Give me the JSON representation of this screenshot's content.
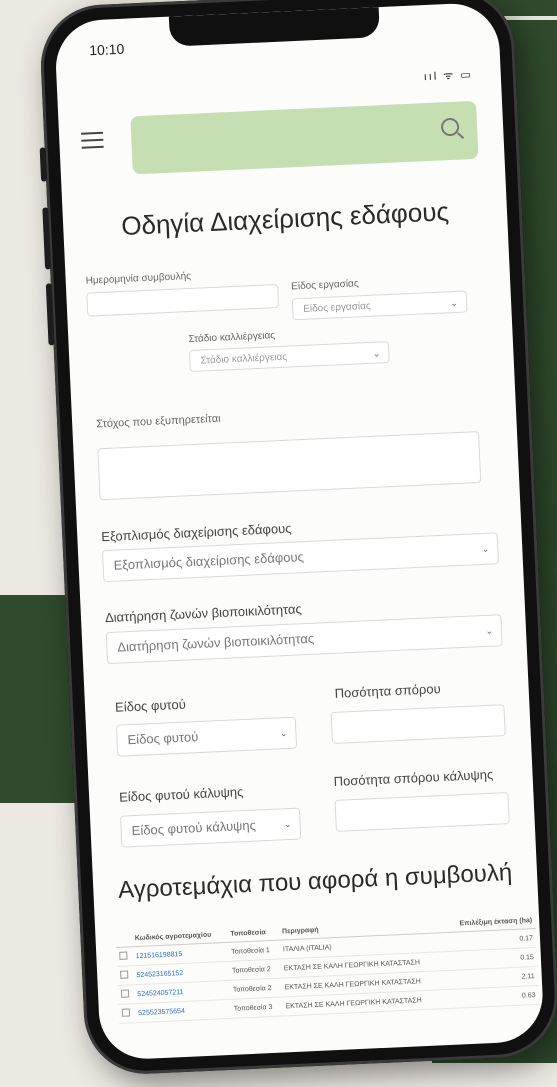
{
  "status_bar": {
    "time": "10:10",
    "icons": "ııl ᯤ ▭"
  },
  "search": {
    "placeholder": ""
  },
  "form": {
    "title": "Οδηγία Διαχείρισης εδάφους",
    "date_label": "Ημερομηνία συμβουλής",
    "work_type_label": "Είδος εργασίας",
    "work_type_value": "Είδος εργασίας",
    "stage_label": "Στάδιο καλλιέργειας",
    "stage_value": "Στάδιο καλλιέργειας",
    "goal_label": "Στόχος που εξυπηρετείται",
    "equipment_label": "Εξοπλισμός διαχείρισης εδάφους",
    "equipment_value": "Εξοπλισμός διαχείρισης εδάφους",
    "biodiversity_label": "Διατήρηση ζωνών βιοποικιλότητας",
    "biodiversity_value": "Διατήρηση ζωνών βιοποικιλότητας",
    "plant_label": "Είδος φυτού",
    "plant_value": "Είδος φυτού",
    "seed_qty_label": "Ποσότητα σπόρου",
    "cover_plant_label": "Είδος φυτού κάλυψης",
    "cover_plant_value": "Είδος φυτού κάλυψης",
    "cover_seed_qty_label": "Ποσότητα σπόρου κάλυψης"
  },
  "parcels": {
    "title": "Αγροτεμάχια που αφορά η συμβουλή",
    "headers": [
      "",
      "Κωδικός αγροτεμαχίου",
      "Τοποθεσία",
      "Περιγραφή",
      "Επιλέξιμη έκταση (ha)"
    ],
    "rows": [
      {
        "code": "121516198815",
        "location": "Τοποθεσία 1",
        "description": "ΙΤΑΛΙΑ (ITALIA)",
        "area": "0.17"
      },
      {
        "code": "524523165152",
        "location": "Τοποθεσία 2",
        "description": "ΕΚΤΑΣΗ ΣΕ ΚΑΛΗ ΓΕΩΡΓΙΚΗ ΚΑΤΑΣΤΑΣΗ",
        "area": "0.15"
      },
      {
        "code": "524524057211",
        "location": "Τοποθεσία 2",
        "description": "ΕΚΤΑΣΗ ΣΕ ΚΑΛΗ ΓΕΩΡΓΙΚΗ ΚΑΤΑΣΤΑΣΗ",
        "area": "2.11"
      },
      {
        "code": "525523575654",
        "location": "Τοποθεσία 3",
        "description": "ΕΚΤΑΣΗ ΣΕ ΚΑΛΗ ΓΕΩΡΓΙΚΗ ΚΑΤΑΣΤΑΣΗ",
        "area": "0.63"
      }
    ]
  }
}
